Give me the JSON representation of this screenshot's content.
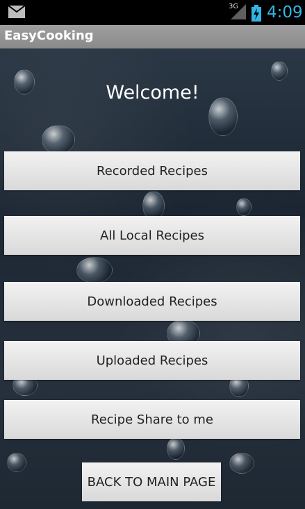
{
  "status_bar": {
    "network": "3G",
    "time": "4:09",
    "icons": [
      "mail-icon",
      "signal-icon",
      "battery-charging-icon"
    ],
    "accent_color": "#33b5e5"
  },
  "action_bar": {
    "title": "EasyCooking"
  },
  "main": {
    "welcome": "Welcome!",
    "buttons": {
      "recorded": "Recorded Recipes",
      "all_local": "All Local Recipes",
      "downloaded": "Downloaded Recipes",
      "uploaded": "Uploaded Recipes",
      "share_to_me": "Recipe Share to me"
    },
    "back_button": "BACK TO MAIN PAGE"
  }
}
